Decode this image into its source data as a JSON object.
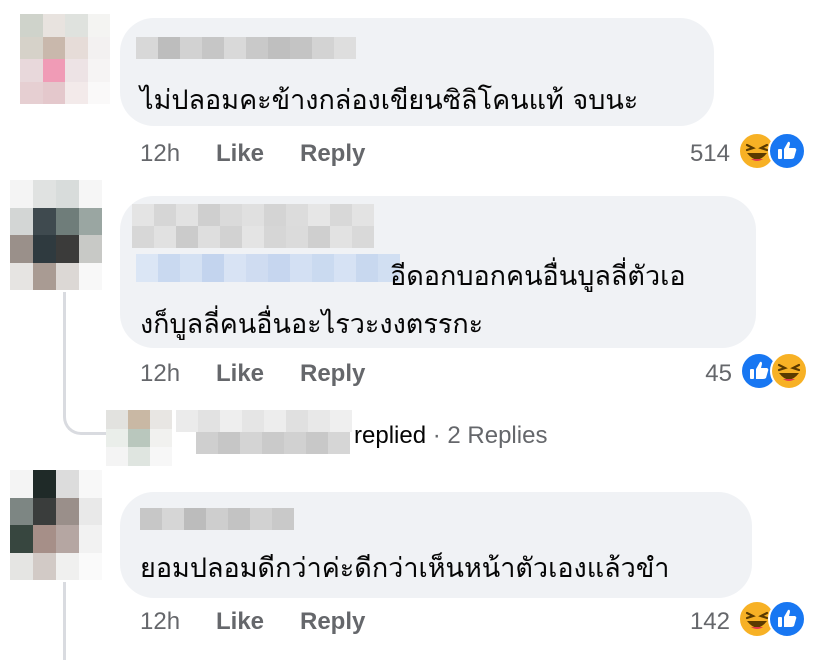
{
  "comments": [
    {
      "text_lines": [
        "ไม่ปลอมคะข้างกล่องเขียนซิลิโคนแท้ จบนะ"
      ],
      "time": "12h",
      "like_label": "Like",
      "reply_label": "Reply",
      "reaction_count": "514",
      "reactions": [
        "haha-icon",
        "like-icon"
      ]
    },
    {
      "text_lines": [
        "อีดอกบอกคนอื่นบูลลี่ตัวเอ",
        "งก็บูลลี่คนอื่นอะไรวะงงตรรกะ"
      ],
      "time": "12h",
      "like_label": "Like",
      "reply_label": "Reply",
      "reaction_count": "45",
      "reactions": [
        "like-icon",
        "haha-icon"
      ],
      "replies_summary": {
        "replied_label": "replied",
        "separator": "·",
        "replies_label": "2 Replies"
      }
    },
    {
      "text_lines": [
        "ยอมปลอมดีกว่าค่ะดีกว่าเห็นหน้าตัวเองแล้วขำ"
      ],
      "time": "12h",
      "like_label": "Like",
      "reply_label": "Reply",
      "reaction_count": "142",
      "reactions": [
        "haha-icon",
        "like-icon"
      ]
    }
  ],
  "colors": {
    "bubble": "#f0f2f5",
    "meta_text": "#65676b",
    "like_blue": "#1877f2",
    "haha_yellow": "#f7b125"
  }
}
